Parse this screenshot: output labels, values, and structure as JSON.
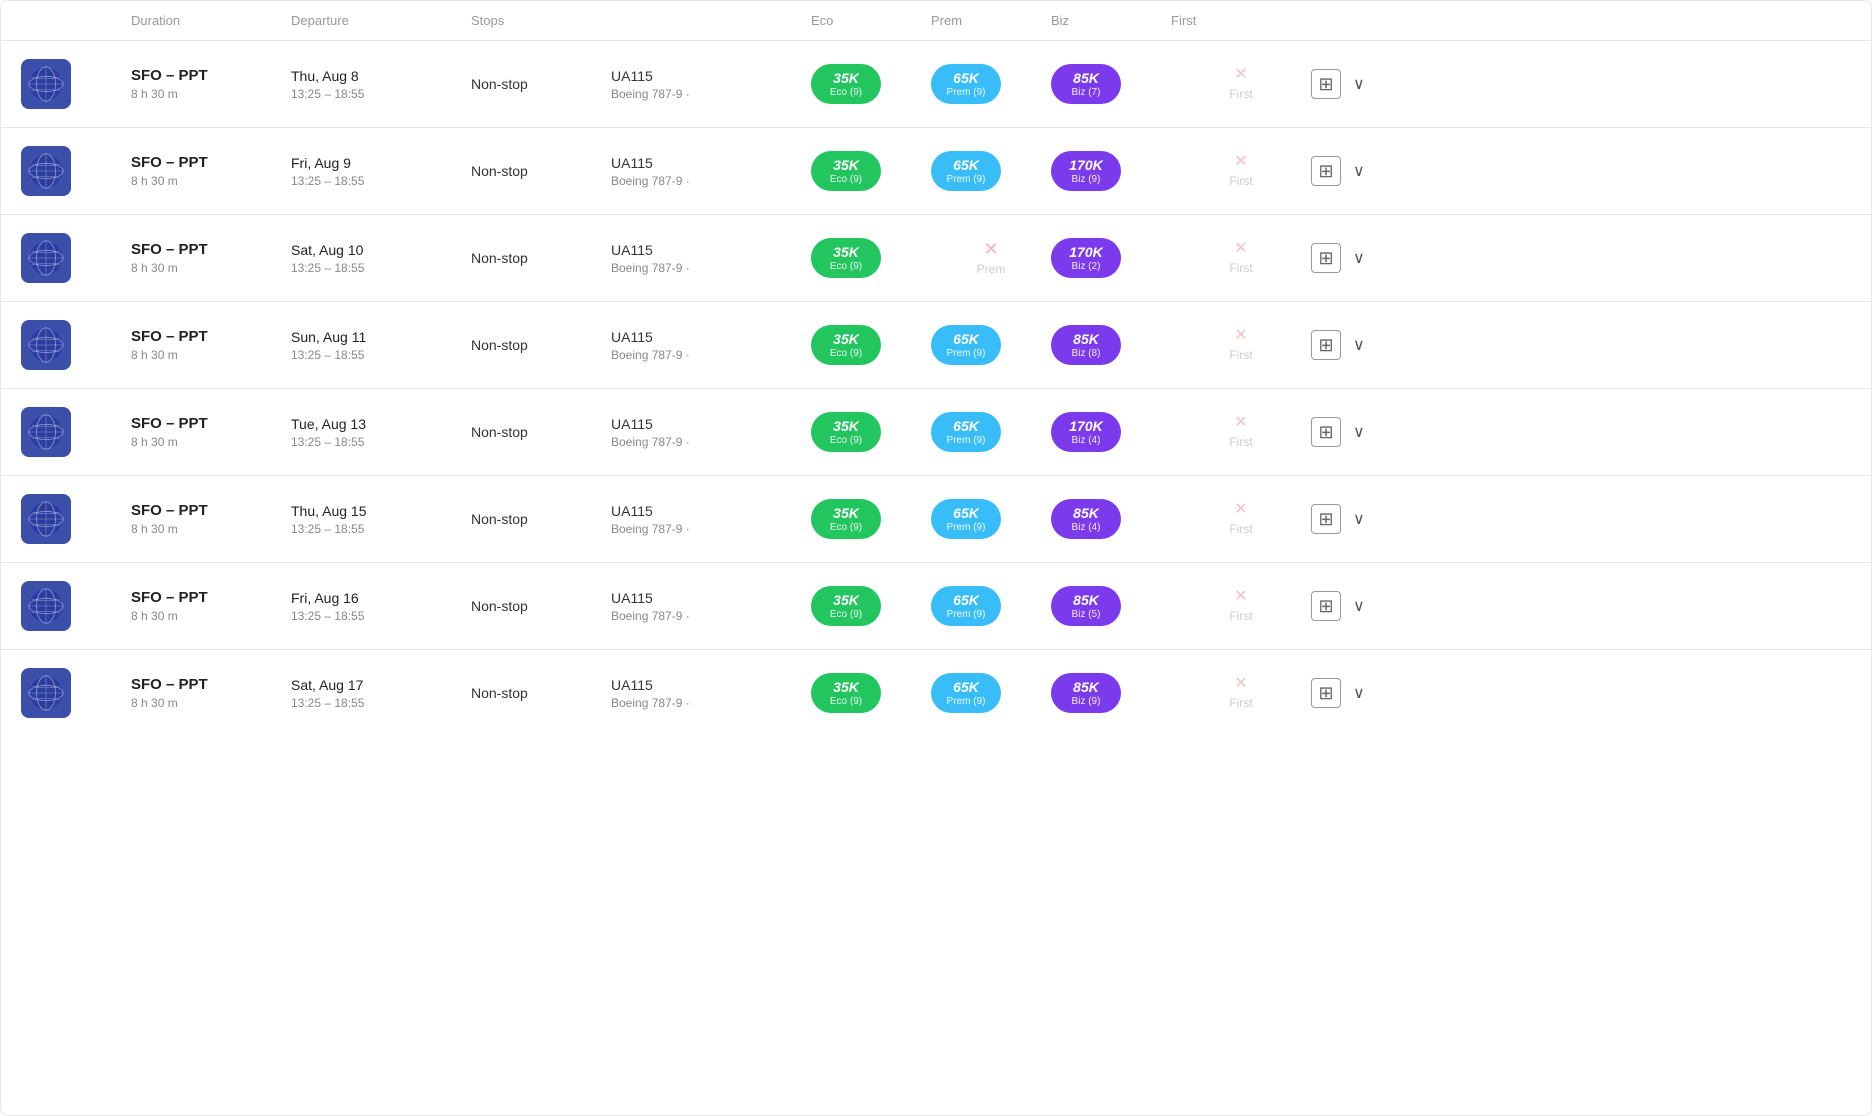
{
  "colors": {
    "eco": "#22c55e",
    "prem": "#38bdf8",
    "biz": "#7c3aed",
    "unavailable": "#f0b8b8"
  },
  "header": {
    "columns": [
      "",
      "Duration",
      "Departure",
      "Stops",
      "",
      "Eco",
      "Prem",
      "Biz",
      "First",
      ""
    ]
  },
  "flights": [
    {
      "id": 1,
      "route": "SFO – PPT",
      "duration": "8 h 30 m",
      "date": "Thu, Aug 8",
      "time": "13:25 – 18:55",
      "stops": "Non-stop",
      "flightNum": "UA115",
      "aircraft": "Boeing 787-9 ·",
      "eco": {
        "points": "35K",
        "cabin": "Eco (9)",
        "available": true
      },
      "prem": {
        "points": "65K",
        "cabin": "Prem (9)",
        "available": true
      },
      "biz": {
        "points": "85K",
        "cabin": "Biz (7)",
        "available": true
      },
      "first": {
        "available": false,
        "label": "First"
      }
    },
    {
      "id": 2,
      "route": "SFO – PPT",
      "duration": "8 h 30 m",
      "date": "Fri, Aug 9",
      "time": "13:25 – 18:55",
      "stops": "Non-stop",
      "flightNum": "UA115",
      "aircraft": "Boeing 787-9 ·",
      "eco": {
        "points": "35K",
        "cabin": "Eco (9)",
        "available": true
      },
      "prem": {
        "points": "65K",
        "cabin": "Prem (9)",
        "available": true
      },
      "biz": {
        "points": "170K",
        "cabin": "Biz (9)",
        "available": true
      },
      "first": {
        "available": false,
        "label": "First"
      }
    },
    {
      "id": 3,
      "route": "SFO – PPT",
      "duration": "8 h 30 m",
      "date": "Sat, Aug 10",
      "time": "13:25 – 18:55",
      "stops": "Non-stop",
      "flightNum": "UA115",
      "aircraft": "Boeing 787-9 ·",
      "eco": {
        "points": "35K",
        "cabin": "Eco (9)",
        "available": true
      },
      "prem": {
        "points": "",
        "cabin": "Prem",
        "available": false
      },
      "biz": {
        "points": "170K",
        "cabin": "Biz (2)",
        "available": true
      },
      "first": {
        "available": false,
        "label": "First"
      }
    },
    {
      "id": 4,
      "route": "SFO – PPT",
      "duration": "8 h 30 m",
      "date": "Sun, Aug 11",
      "time": "13:25 – 18:55",
      "stops": "Non-stop",
      "flightNum": "UA115",
      "aircraft": "Boeing 787-9 ·",
      "eco": {
        "points": "35K",
        "cabin": "Eco (9)",
        "available": true
      },
      "prem": {
        "points": "65K",
        "cabin": "Prem (9)",
        "available": true
      },
      "biz": {
        "points": "85K",
        "cabin": "Biz (8)",
        "available": true
      },
      "first": {
        "available": false,
        "label": "First"
      }
    },
    {
      "id": 5,
      "route": "SFO – PPT",
      "duration": "8 h 30 m",
      "date": "Tue, Aug 13",
      "time": "13:25 – 18:55",
      "stops": "Non-stop",
      "flightNum": "UA115",
      "aircraft": "Boeing 787-9 ·",
      "eco": {
        "points": "35K",
        "cabin": "Eco (9)",
        "available": true
      },
      "prem": {
        "points": "65K",
        "cabin": "Prem (9)",
        "available": true
      },
      "biz": {
        "points": "170K",
        "cabin": "Biz (4)",
        "available": true
      },
      "first": {
        "available": false,
        "label": "First"
      }
    },
    {
      "id": 6,
      "route": "SFO – PPT",
      "duration": "8 h 30 m",
      "date": "Thu, Aug 15",
      "time": "13:25 – 18:55",
      "stops": "Non-stop",
      "flightNum": "UA115",
      "aircraft": "Boeing 787-9 ·",
      "eco": {
        "points": "35K",
        "cabin": "Eco (9)",
        "available": true
      },
      "prem": {
        "points": "65K",
        "cabin": "Prem (9)",
        "available": true
      },
      "biz": {
        "points": "85K",
        "cabin": "Biz (4)",
        "available": true
      },
      "first": {
        "available": false,
        "label": "First"
      }
    },
    {
      "id": 7,
      "route": "SFO – PPT",
      "duration": "8 h 30 m",
      "date": "Fri, Aug 16",
      "time": "13:25 – 18:55",
      "stops": "Non-stop",
      "flightNum": "UA115",
      "aircraft": "Boeing 787-9 ·",
      "eco": {
        "points": "35K",
        "cabin": "Eco (9)",
        "available": true
      },
      "prem": {
        "points": "65K",
        "cabin": "Prem (9)",
        "available": true
      },
      "biz": {
        "points": "85K",
        "cabin": "Biz (5)",
        "available": true
      },
      "first": {
        "available": false,
        "label": "First"
      }
    },
    {
      "id": 8,
      "route": "SFO – PPT",
      "duration": "8 h 30 m",
      "date": "Sat, Aug 17",
      "time": "13:25 – 18:55",
      "stops": "Non-stop",
      "flightNum": "UA115",
      "aircraft": "Boeing 787-9 ·",
      "eco": {
        "points": "35K",
        "cabin": "Eco (9)",
        "available": true
      },
      "prem": {
        "points": "65K",
        "cabin": "Prem (9)",
        "available": true
      },
      "biz": {
        "points": "85K",
        "cabin": "Biz (9)",
        "available": true
      },
      "first": {
        "available": false,
        "label": "First"
      }
    }
  ]
}
